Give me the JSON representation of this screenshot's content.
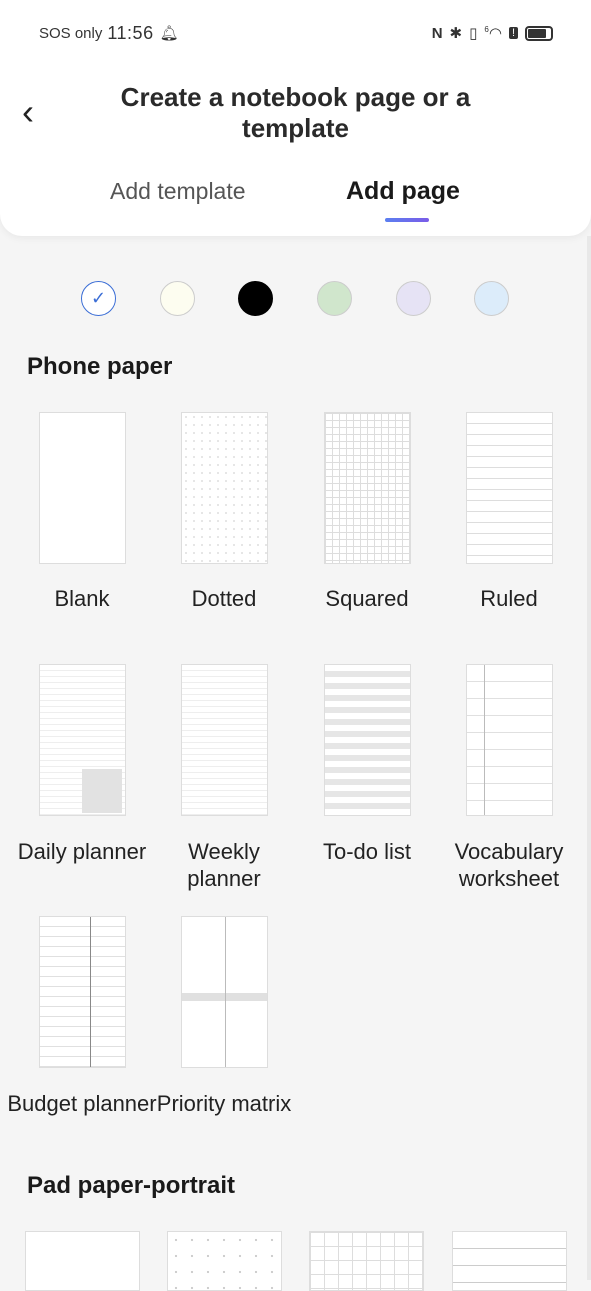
{
  "status_bar": {
    "carrier": "SOS only",
    "time": "11:56",
    "icons": [
      "bell-icon",
      "nfc-icon",
      "bluetooth-icon",
      "vibrate-icon",
      "wifi-icon",
      "alert-icon",
      "battery-icon"
    ],
    "wifi_badge": "6"
  },
  "header": {
    "title": "Create a notebook page or a template",
    "tabs": [
      {
        "label": "Add template",
        "active": false
      },
      {
        "label": "Add page",
        "active": true
      }
    ],
    "accent": "#6a6ee8"
  },
  "colors": [
    {
      "hex": "#ffffff",
      "selected": true
    },
    {
      "hex": "#fdfdf0",
      "selected": false
    },
    {
      "hex": "#000000",
      "selected": false
    },
    {
      "hex": "#d0e6cc",
      "selected": false
    },
    {
      "hex": "#e6e3f5",
      "selected": false
    },
    {
      "hex": "#dcecfa",
      "selected": false
    }
  ],
  "sections": [
    {
      "title": "Phone paper",
      "items": [
        {
          "label": "Blank"
        },
        {
          "label": "Dotted"
        },
        {
          "label": "Squared"
        },
        {
          "label": "Ruled"
        },
        {
          "label": "Daily planner"
        },
        {
          "label": "Weekly planner"
        },
        {
          "label": "To-do list"
        },
        {
          "label": "Vocabulary worksheet"
        },
        {
          "label": "Budget planner"
        },
        {
          "label": "Priority matrix"
        }
      ]
    },
    {
      "title": "Pad paper-portrait"
    }
  ]
}
